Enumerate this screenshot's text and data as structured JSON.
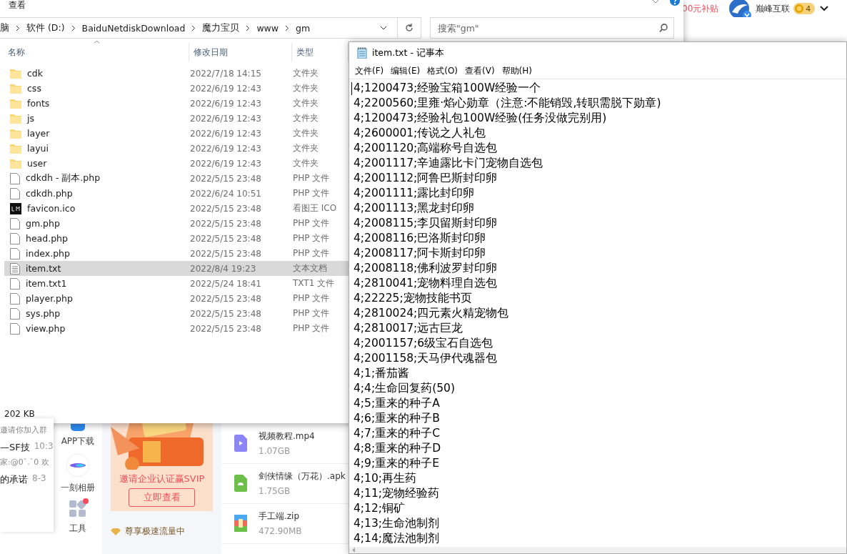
{
  "netdisk": {
    "promo_link": "00元补贴",
    "user_name": "巅峰互联",
    "level_badge": "4",
    "chat_items": [
      {
        "subtitle": "邀请你加入群"
      },
      {
        "title": "—SF技",
        "time": "10:3",
        "subtitle": "家:@0`.`0 欢"
      },
      {
        "title": "的承诺",
        "time": "8-3"
      }
    ],
    "side_tools": [
      {
        "label": "APP下载",
        "kind": "app",
        "notification": false
      },
      {
        "label": "一刻相册",
        "kind": "album",
        "notification": false
      },
      {
        "label": "工具",
        "kind": "tools",
        "notification": true
      }
    ],
    "promo": {
      "kind": "picture",
      "headline": "邀请企业认证赢SVIP",
      "button": "立即查看",
      "footer": "尊享极速流量中"
    },
    "files": [
      {
        "name": "视频教程.mp4",
        "size": "1.07GB",
        "kind": "video"
      },
      {
        "name": "剑侠情缘（万花）.apk",
        "size": "1.75GB",
        "kind": "apk"
      },
      {
        "name": "手工端.zip",
        "size": "472.90MB",
        "kind": "zip"
      }
    ]
  },
  "explorer": {
    "ribbon_tab": "查看",
    "breadcrumb": [
      "脑",
      "软件 (D:)",
      "BaiduNetdiskDownload",
      "魔力宝贝",
      "www",
      "gm"
    ],
    "search": {
      "placeholder": "搜索\"gm\""
    },
    "columns": [
      "名称",
      "修改日期",
      "类型"
    ],
    "rows": [
      {
        "name": "cdk",
        "date": "2022/7/18 14:15",
        "type": "文件夹",
        "kind": "folder",
        "selected": false
      },
      {
        "name": "css",
        "date": "2022/6/19 12:43",
        "type": "文件夹",
        "kind": "folder",
        "selected": false
      },
      {
        "name": "fonts",
        "date": "2022/6/19 12:43",
        "type": "文件夹",
        "kind": "folder",
        "selected": false
      },
      {
        "name": "js",
        "date": "2022/6/19 12:43",
        "type": "文件夹",
        "kind": "folder",
        "selected": false
      },
      {
        "name": "layer",
        "date": "2022/6/19 12:43",
        "type": "文件夹",
        "kind": "folder",
        "selected": false
      },
      {
        "name": "layui",
        "date": "2022/6/19 12:43",
        "type": "文件夹",
        "kind": "folder",
        "selected": false
      },
      {
        "name": "user",
        "date": "2022/6/19 12:43",
        "type": "文件夹",
        "kind": "folder",
        "selected": false
      },
      {
        "name": "cdkdh - 副本.php",
        "date": "2022/5/15 23:48",
        "type": "PHP 文件",
        "kind": "file",
        "selected": false
      },
      {
        "name": "cdkdh.php",
        "date": "2022/6/24 10:51",
        "type": "PHP 文件",
        "kind": "file",
        "selected": false
      },
      {
        "name": "favicon.ico",
        "date": "2022/5/15 23:48",
        "type": "看图王 ICO",
        "kind": "ico",
        "selected": false
      },
      {
        "name": "gm.php",
        "date": "2022/5/15 23:48",
        "type": "PHP 文件",
        "kind": "file",
        "selected": false
      },
      {
        "name": "head.php",
        "date": "2022/5/15 23:48",
        "type": "PHP 文件",
        "kind": "file",
        "selected": false
      },
      {
        "name": "index.php",
        "date": "2022/5/15 23:48",
        "type": "PHP 文件",
        "kind": "file",
        "selected": false
      },
      {
        "name": "item.txt",
        "date": "2022/8/4 19:23",
        "type": "文本文档",
        "kind": "text",
        "selected": true
      },
      {
        "name": "item.txt1",
        "date": "2022/5/24 18:41",
        "type": "TXT1 文件",
        "kind": "file",
        "selected": false
      },
      {
        "name": "player.php",
        "date": "2022/5/15 23:48",
        "type": "PHP 文件",
        "kind": "file",
        "selected": false
      },
      {
        "name": "sys.php",
        "date": "2022/5/15 23:48",
        "type": "PHP 文件",
        "kind": "file",
        "selected": false
      },
      {
        "name": "view.php",
        "date": "2022/5/15 23:48",
        "type": "PHP 文件",
        "kind": "file",
        "selected": false
      }
    ],
    "status_bar": "202 KB"
  },
  "notepad": {
    "title": "item.txt - 记事本",
    "menu": [
      "文件(F)",
      "编辑(E)",
      "格式(O)",
      "查看(V)",
      "帮助(H)"
    ],
    "lines": [
      "4;1200473;经验宝箱100W经验一个",
      "4;2200560;里雍·焰心勋章（注意:不能销毁,转职需脱下勋章)",
      "4;1200473;经验礼包100W经验(任务没做完别用)",
      "4;2600001;传说之人礼包",
      "4;2001120;高端称号自选包",
      "4;2001117;辛迪露比卡门宠物自选包",
      "4;2001112;阿鲁巴斯封印卵",
      "4;2001111;露比封印卵",
      "4;2001113;黑龙封印卵",
      "4;2008115;李贝留斯封印卵",
      "4;2008116;巴洛斯封印卵",
      "4;2008117;阿卡斯封印卵",
      "4;2008118;佛利波罗封印卵",
      "4;2810041;宠物料理自选包",
      "4;22225;宠物技能书页",
      "4;2810024;四元素火精宠物包",
      "4;2810017;远古巨龙",
      "4;2001157;6级宝石自选包",
      "4;2001158;天马伊代魂器包",
      "4;1;番茄酱",
      "4;4;生命回复药(50)",
      "4;5;重来的种子A",
      "4;6;重来的种子B",
      "4;7;重来的种子C",
      "4;8;重来的种子D",
      "4;9;重来的种子E",
      "4;10;再生药",
      "4;11;宠物经验药",
      "4;12;铜矿",
      "4;13;生命池制剂",
      "4;14;魔法池制剂"
    ]
  }
}
